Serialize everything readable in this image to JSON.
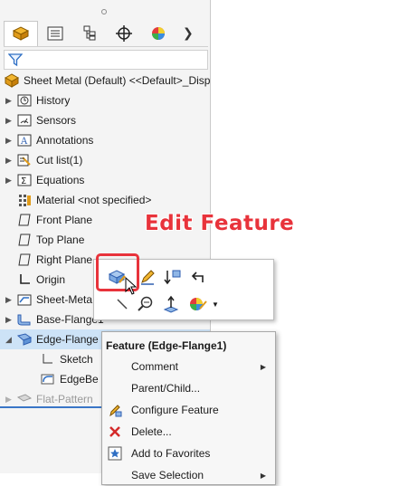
{
  "tree": {
    "root_label": "Sheet Metal (Default) <<Default>_Disp",
    "items": [
      {
        "label": "History"
      },
      {
        "label": "Sensors"
      },
      {
        "label": "Annotations"
      },
      {
        "label": "Cut list(1)"
      },
      {
        "label": "Equations"
      },
      {
        "label": "Material <not specified>"
      },
      {
        "label": "Front Plane"
      },
      {
        "label": "Top Plane"
      },
      {
        "label": "Right Plane"
      },
      {
        "label": "Origin"
      },
      {
        "label": "Sheet-Meta"
      },
      {
        "label": "Base-Flange1"
      },
      {
        "label": "Edge-Flange"
      },
      {
        "label": "Sketch"
      },
      {
        "label": "EdgeBe"
      },
      {
        "label": "Flat-Pattern"
      }
    ]
  },
  "callout": "Edit Feature",
  "menu": {
    "title": "Feature (Edge-Flange1)",
    "items": [
      {
        "label": "Comment"
      },
      {
        "label": "Parent/Child..."
      },
      {
        "label": "Configure Feature"
      },
      {
        "label": "Delete..."
      },
      {
        "label": "Add to Favorites"
      },
      {
        "label": "Save Selection"
      }
    ]
  },
  "colors": {
    "accent_red": "#e8333b",
    "selection": "#cde3f7",
    "divider_blue": "#3a76c7"
  }
}
